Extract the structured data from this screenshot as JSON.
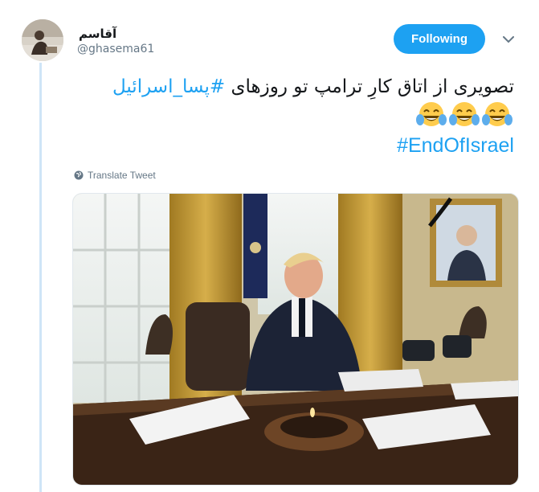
{
  "user": {
    "display_name": "آقاسم",
    "screen_name": "@ghasema61",
    "avatar_icon": "user-avatar-photo"
  },
  "follow_button": {
    "label": "Following",
    "color": "#1da1f2"
  },
  "more_menu": {
    "icon": "chevron-down-icon"
  },
  "tweet": {
    "text": "تصویری از اتاق کارِ ترامپ تو روزهای",
    "hashtag_fa": "#پسا_اسرائیل",
    "emojis": [
      "face-with-tears-of-joy-icon",
      "face-with-tears-of-joy-icon",
      "face-with-tears-of-joy-icon"
    ],
    "hashtag_en": "#EndOfIsrael",
    "hashtag_color": "#1da1f2"
  },
  "translate": {
    "label": "Translate Tweet",
    "icon": "globe-icon"
  },
  "media": {
    "description_icon": "oval-office-photo"
  }
}
